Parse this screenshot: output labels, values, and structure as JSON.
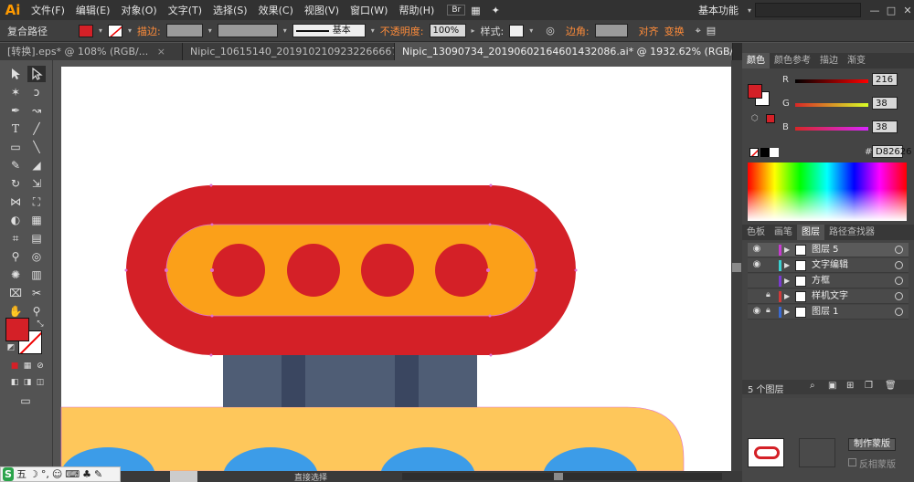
{
  "app": {
    "logo": "Ai"
  },
  "menu": {
    "items": [
      "文件(F)",
      "编辑(E)",
      "对象(O)",
      "文字(T)",
      "选择(S)",
      "效果(C)",
      "视图(V)",
      "窗口(W)",
      "帮助(H)"
    ],
    "workspace": "基本功能",
    "workspace_arrow": "▾",
    "minimize": "—",
    "maximize": "□",
    "close": "✕"
  },
  "control": {
    "selection_type": "复合路径",
    "stroke_label": "描边:",
    "stroke_profile": "基本",
    "opacity_label": "不透明度:",
    "opacity_value": "100%",
    "style_label": "样式:",
    "corner_label": "边角:",
    "align_label": "对齐",
    "transform_label": "变换",
    "fill_color": "#d42027"
  },
  "tabs": [
    {
      "label": "[转换].eps* @ 108% (RGB/...",
      "active": false
    },
    {
      "label": "Nipic_10615140_20191021092322666676.ai*",
      "active": false
    },
    {
      "label": "Nipic_13090734_20190602164601432086.ai* @ 1932.62% (RGB/预览)",
      "active": true
    }
  ],
  "tab_close": "×",
  "colors": {
    "red": "#d42027",
    "orange": "#fba019",
    "navy": "#4f5d75",
    "navy_dark": "#3a4660",
    "yellow": "#fec75b",
    "blue": "#3c9ce8",
    "anchor": "#e070d0"
  },
  "color_panel": {
    "tabs": [
      "颜色",
      "颜色参考",
      "描边",
      "渐变"
    ],
    "r_label": "R",
    "r_value": "216",
    "g_label": "G",
    "g_value": "38",
    "b_label": "B",
    "b_value": "38",
    "hex_label": "#",
    "hex_value": "D82626"
  },
  "layers_panel": {
    "tabs": [
      "色板",
      "画笔",
      "图层",
      "路径查找器"
    ],
    "layers": [
      {
        "name": "图层 5",
        "visible": true,
        "locked": false,
        "color": "#c83ad1",
        "selected": true
      },
      {
        "name": "文字编辑",
        "visible": true,
        "locked": false,
        "color": "#3ad1d1",
        "selected": false
      },
      {
        "name": "方框",
        "visible": false,
        "locked": false,
        "color": "#7a3ad1",
        "selected": false
      },
      {
        "name": "样机文字",
        "visible": false,
        "locked": true,
        "color": "#d13a3a",
        "selected": false
      },
      {
        "name": "图层 1",
        "visible": true,
        "locked": true,
        "color": "#3a6ad1",
        "selected": false
      }
    ],
    "count": "5 个图层",
    "make_mask": "制作蒙版",
    "invert_mask": "反相蒙版"
  },
  "status": {
    "tool_name": "直接选择"
  },
  "ime": {
    "labels": [
      "S",
      "五",
      "☽",
      "°,",
      "☺",
      "⌨",
      "♣",
      "✎"
    ]
  }
}
